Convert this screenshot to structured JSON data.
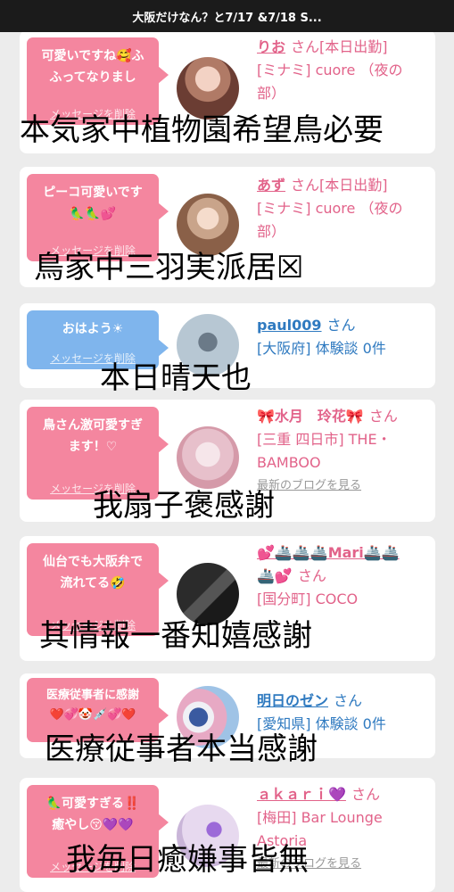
{
  "header": {
    "title": "大阪だけなん？と7/17 &7/18 S..."
  },
  "common": {
    "delete_label": "メッセージを削除",
    "san": "さん",
    "blog_label": "最新のブログを見る"
  },
  "cards": [
    {
      "bubble_color": "pink",
      "message_line1": "可愛いですね🥰ふ",
      "message_line2": "ふってなりまし",
      "name": "りお",
      "name_suffix": "[本日出勤]",
      "detail1": "[ミナミ] cuore （夜の",
      "detail2": "部）",
      "overlay": "本気家中植物園希望鳥必要"
    },
    {
      "bubble_color": "pink",
      "message_line1": "ピーコ可愛いです",
      "message_line2": "🦜🦜💕",
      "name": "あず",
      "name_suffix": "[本日出勤]",
      "detail1": "[ミナミ] cuore （夜の",
      "detail2": "部）",
      "overlay": "鳥家中三羽実派居☒"
    },
    {
      "bubble_color": "blue",
      "message_line1": "おはよう☀",
      "message_line2": "",
      "name": "paul009",
      "name_suffix": "",
      "detail1": "[大阪府] 体験談 0件",
      "detail2": "",
      "overlay": "本日晴天也"
    },
    {
      "bubble_color": "pink",
      "message_line1": "鳥さん激可愛すぎ",
      "message_line2": "ます！♡",
      "name": "🎀水月　玲花🎀",
      "name_suffix": "",
      "detail1": "[三重 四日市] THE・",
      "detail2": "BAMBOO",
      "overlay": "我扇子褒感謝"
    },
    {
      "bubble_color": "pink",
      "message_line1": "仙台でも大阪弁で",
      "message_line2": "流れてる🤣",
      "name": "💕🚢🚢🚢Mari🚢🚢",
      "name_suffix": "",
      "name_line2": "🚢💕",
      "detail1": "[国分町] COCO",
      "detail2": "",
      "overlay": "其情報一番知嬉感謝"
    },
    {
      "bubble_color": "pink",
      "message_line1": "医療従事者に感謝",
      "message_line2": "❤️💞🤡💉💞❤️",
      "name": "明日のゼン",
      "name_suffix": "",
      "detail1": "[愛知県] 体験談 0件",
      "detail2": "",
      "overlay": "医療従事者本当感謝"
    },
    {
      "bubble_color": "pink",
      "message_line1": "🦜可愛すぎる‼️",
      "message_line2": "癒やし😚💜💜",
      "name": "ａｋａｒｉ💜",
      "name_suffix": "",
      "detail1": "[梅田] Bar Lounge",
      "detail2": "Astoria",
      "overlay": "我毎日癒嫌事皆無"
    }
  ]
}
